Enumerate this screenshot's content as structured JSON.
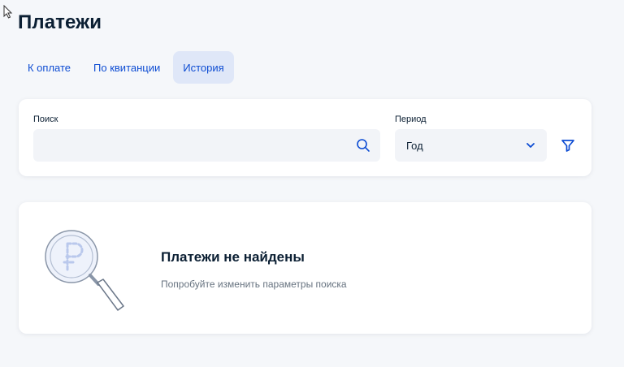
{
  "page": {
    "title": "Платежи"
  },
  "tabs": [
    {
      "label": "К оплате",
      "active": false
    },
    {
      "label": "По квитанции",
      "active": false
    },
    {
      "label": "История",
      "active": true
    }
  ],
  "filters": {
    "search_label": "Поиск",
    "search_value": "",
    "period_label": "Период",
    "period_value": "Год",
    "icons": {
      "search": "search-icon",
      "chevron": "chevron-down-icon",
      "filter": "filter-icon"
    }
  },
  "empty_state": {
    "title": "Платежи не найдены",
    "subtitle": "Попробуйте изменить параметры поиска",
    "illustration": "magnifier-ruble-icon"
  },
  "colors": {
    "accent": "#0d4cd3",
    "tab_active_bg": "#dfe7f8",
    "page_bg": "#f5f7fa",
    "input_bg": "#f2f4f8",
    "text": "#0b1f33",
    "muted": "#66727f"
  }
}
